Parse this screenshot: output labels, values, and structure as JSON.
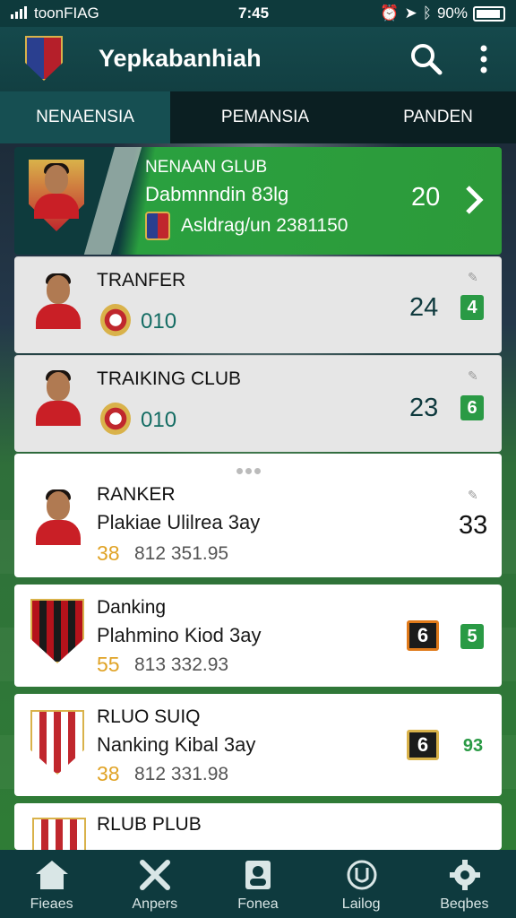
{
  "status": {
    "carrier": "toonFIAG",
    "time": "7:45",
    "battery": "90%"
  },
  "header": {
    "title": "Yepkabanhiah"
  },
  "tabs": [
    {
      "label": "NENAENSIA",
      "active": true
    },
    {
      "label": "PEMANSIA",
      "active": false
    },
    {
      "label": "PANDEN",
      "active": false
    }
  ],
  "featured": {
    "club": "NENAAN GLUB",
    "line1": "Dabmnndin 83lg",
    "line2": "Asldrag/un 2381150",
    "score": "20"
  },
  "rows": [
    {
      "name": "TRANFER",
      "code": "010",
      "score": "24",
      "box": "4"
    },
    {
      "name": "TRAIKING CLUB",
      "code": "010",
      "score": "23",
      "box": "6"
    }
  ],
  "cards": [
    {
      "name": "RANKER",
      "subtitle": "Plakiae Ulilrea 3ay",
      "number": "38",
      "value": "812 351.95",
      "score": "33"
    },
    {
      "name": "Danking",
      "subtitle": "Plahmino Kiod 3ay",
      "number": "55",
      "value": "813 332.93",
      "badge": "6",
      "box": "5"
    },
    {
      "name": "RLUO SUIQ",
      "subtitle": "Nanking Kibal 3ay",
      "number": "38",
      "value": "812 331.98",
      "badge": "6",
      "box": "93"
    },
    {
      "name": "RLUB PLUB"
    }
  ],
  "nav": [
    {
      "label": "Fieaes",
      "icon": "home-icon"
    },
    {
      "label": "Anpers",
      "icon": "tools-icon"
    },
    {
      "label": "Fonea",
      "icon": "profile-icon"
    },
    {
      "label": "Lailog",
      "icon": "logo-icon"
    },
    {
      "label": "Beqbes",
      "icon": "settings-icon"
    }
  ],
  "colors": {
    "header": "#123f42",
    "accent": "#2aa03f",
    "gold": "#e0a326"
  }
}
